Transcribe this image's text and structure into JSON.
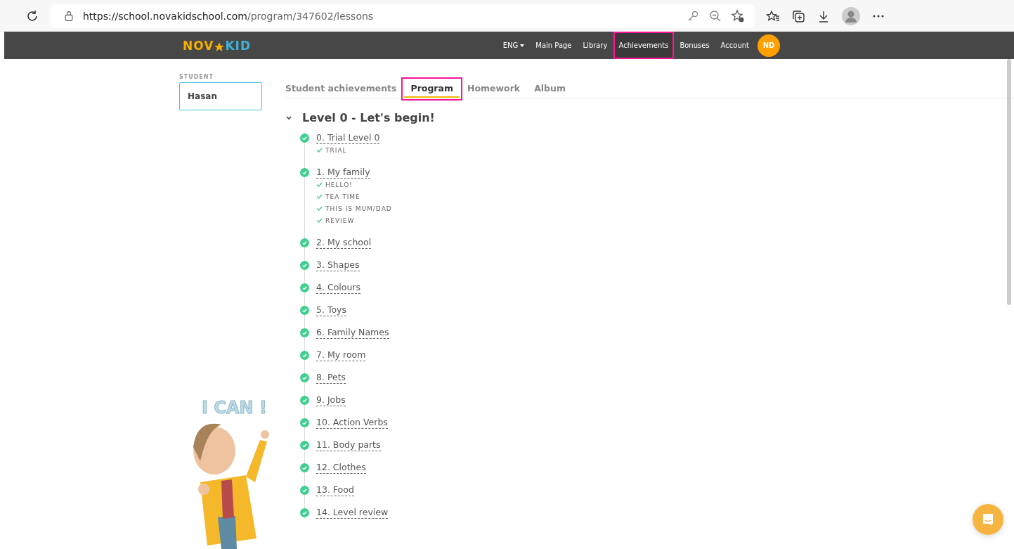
{
  "browser": {
    "url_host": "https://school.novakidschool.com",
    "url_path": "/program/347602/lessons"
  },
  "nav": {
    "logo_left": "NOV",
    "logo_right": "KID",
    "language": "ENG",
    "items": [
      {
        "label": "Main Page",
        "selected": false,
        "highlighted": false
      },
      {
        "label": "Library",
        "selected": false,
        "highlighted": false
      },
      {
        "label": "Achievements",
        "selected": true,
        "highlighted": true
      },
      {
        "label": "Bonuses",
        "selected": false,
        "highlighted": false
      },
      {
        "label": "Account",
        "selected": false,
        "highlighted": false
      }
    ],
    "avatar": "ND"
  },
  "sidebar": {
    "label": "STUDENT",
    "student": "Hasan",
    "illustration_caption": "I CAN !"
  },
  "tabs": [
    {
      "label": "Student achievements",
      "selected": false,
      "highlighted": false
    },
    {
      "label": "Program",
      "selected": true,
      "highlighted": true
    },
    {
      "label": "Homework",
      "selected": false,
      "highlighted": false
    },
    {
      "label": "Album",
      "selected": false,
      "highlighted": false
    }
  ],
  "level": {
    "title": "Level 0 - Let's begin!",
    "expanded": true,
    "lessons": [
      {
        "title": "0. Trial Level 0",
        "done": true,
        "steps": [
          {
            "label": "TRIAL",
            "done": true
          }
        ]
      },
      {
        "title": "1. My family",
        "done": true,
        "steps": [
          {
            "label": "HELLO!",
            "done": true
          },
          {
            "label": "TEA TIME",
            "done": true
          },
          {
            "label": "THIS IS MUM/DAD",
            "done": true
          },
          {
            "label": "REVIEW",
            "done": true
          }
        ]
      },
      {
        "title": "2. My school",
        "done": true
      },
      {
        "title": "3. Shapes",
        "done": true
      },
      {
        "title": "4. Colours",
        "done": true
      },
      {
        "title": "5. Toys",
        "done": true
      },
      {
        "title": "6. Family Names",
        "done": true
      },
      {
        "title": "7. My room",
        "done": true
      },
      {
        "title": "8. Pets",
        "done": true
      },
      {
        "title": "9. Jobs",
        "done": true
      },
      {
        "title": "10. Action Verbs",
        "done": true
      },
      {
        "title": "11. Body parts",
        "done": true
      },
      {
        "title": "12. Clothes",
        "done": true
      },
      {
        "title": "13. Food",
        "done": true
      },
      {
        "title": "14. Level review",
        "done": true
      }
    ]
  }
}
